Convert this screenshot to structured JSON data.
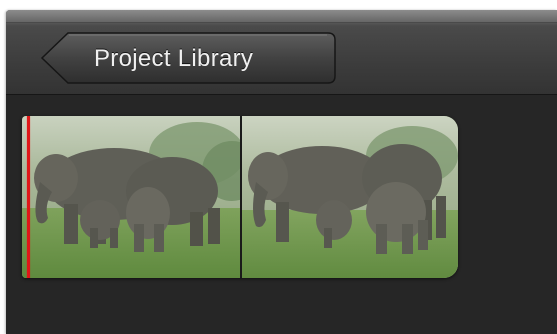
{
  "toolbar": {
    "back_button_label": "Project Library",
    "back_button_icon": "left-arrow-button-shape"
  },
  "clip": {
    "frames": [
      {
        "subject": "elephants-thumbnail"
      },
      {
        "subject": "elephants-thumbnail"
      }
    ],
    "playhead_color": "#e01818"
  }
}
